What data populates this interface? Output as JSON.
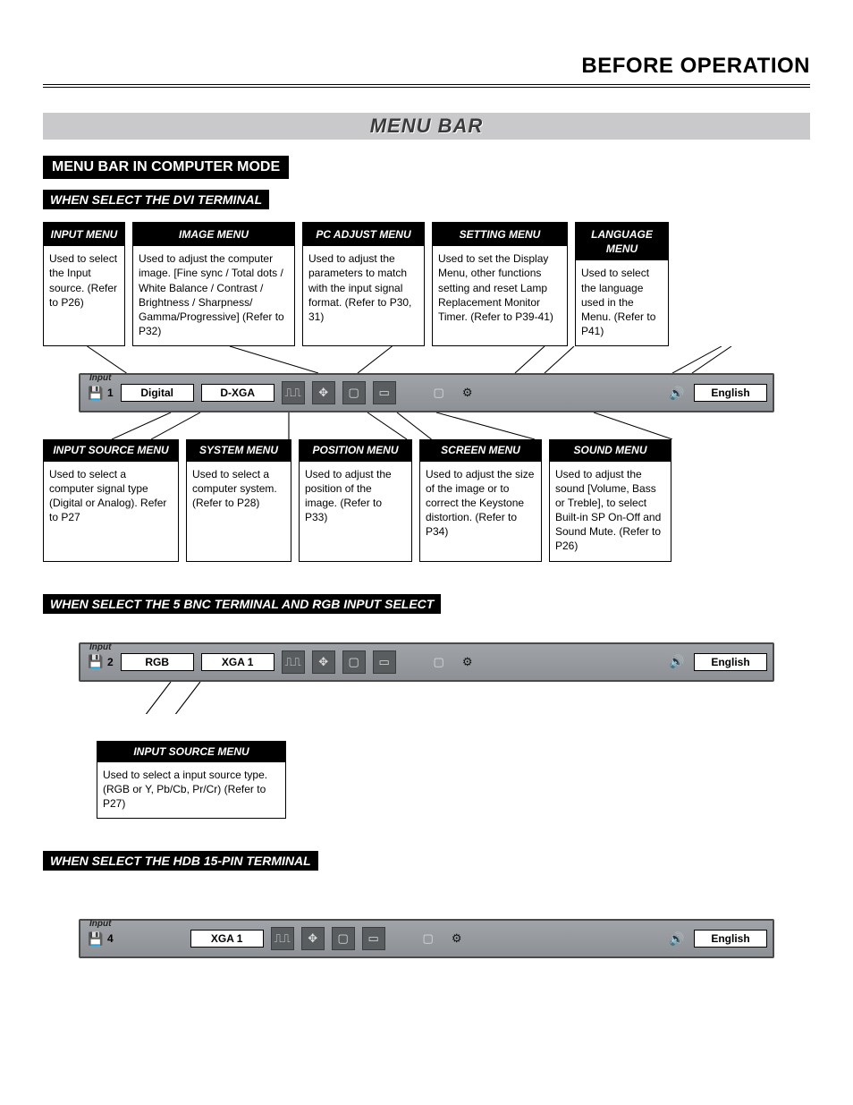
{
  "page": {
    "header": "BEFORE OPERATION",
    "main_title": "MENU BAR",
    "section_title": "MENU BAR IN COMPUTER MODE",
    "sub_dvi": "WHEN SELECT  THE DVI TERMINAL",
    "sub_bnc": "WHEN SELECT THE 5 BNC TERMINAL AND RGB INPUT SELECT",
    "sub_hdb": "WHEN SELECT THE HDB 15-PIN TERMINAL"
  },
  "top_callouts": [
    {
      "title": "INPUT MENU",
      "body": "Used to select the Input source. (Refer to P26)"
    },
    {
      "title": "IMAGE MENU",
      "body": "Used to adjust the computer image.\n[Fine sync / Total dots / White Balance / Contrast / Brightness / Sharpness/ Gamma/Progressive]\n(Refer to P32)"
    },
    {
      "title": "PC ADJUST MENU",
      "body": "Used to adjust the parameters to match with the input signal format.\n(Refer to P30, 31)"
    },
    {
      "title": "SETTING MENU",
      "body": "Used to set the Display Menu, other functions setting and reset Lamp Replacement Monitor Timer. (Refer to P39-41)"
    },
    {
      "title": "LANGUAGE MENU",
      "body": "Used to select the language used in the Menu.\n(Refer to P41)"
    }
  ],
  "bottom_callouts": [
    {
      "title": "INPUT SOURCE MENU",
      "body": "Used to select a computer signal type (Digital or Analog). Refer to P27"
    },
    {
      "title": "SYSTEM MENU",
      "body": "Used to select a computer system.\n(Refer to P28)"
    },
    {
      "title": "POSITION MENU",
      "body": "Used to adjust the position of the image.\n(Refer to P33)"
    },
    {
      "title": "SCREEN MENU",
      "body": "Used to adjust the size of the image or to correct the Keystone distortion.\n(Refer to P34)"
    },
    {
      "title": "SOUND MENU",
      "body": "Used to adjust the sound [Volume, Bass or Treble], to select Built-in SP On-Off and Sound Mute.\n(Refer to P26)"
    }
  ],
  "bnc_callout": {
    "title": "INPUT SOURCE MENU",
    "body": "Used to select a input source type. (RGB or Y, Pb/Cb, Pr/Cr)\n(Refer to P27)"
  },
  "menubar1": {
    "input_label": "Input",
    "input_num": "1",
    "source_btn": "Digital",
    "system_btn": "D-XGA",
    "lang_btn": "English"
  },
  "menubar2": {
    "input_label": "Input",
    "input_num": "2",
    "source_btn": "RGB",
    "system_btn": "XGA 1",
    "lang_btn": "English"
  },
  "menubar3": {
    "input_label": "Input",
    "input_num": "4",
    "system_btn": "XGA 1",
    "lang_btn": "English"
  },
  "icons": {
    "computer": "💾",
    "sliders": "⎍⎍",
    "move": "✥",
    "screen": "▭",
    "page": "▢",
    "settings": "⚙",
    "sound": "🔊"
  }
}
